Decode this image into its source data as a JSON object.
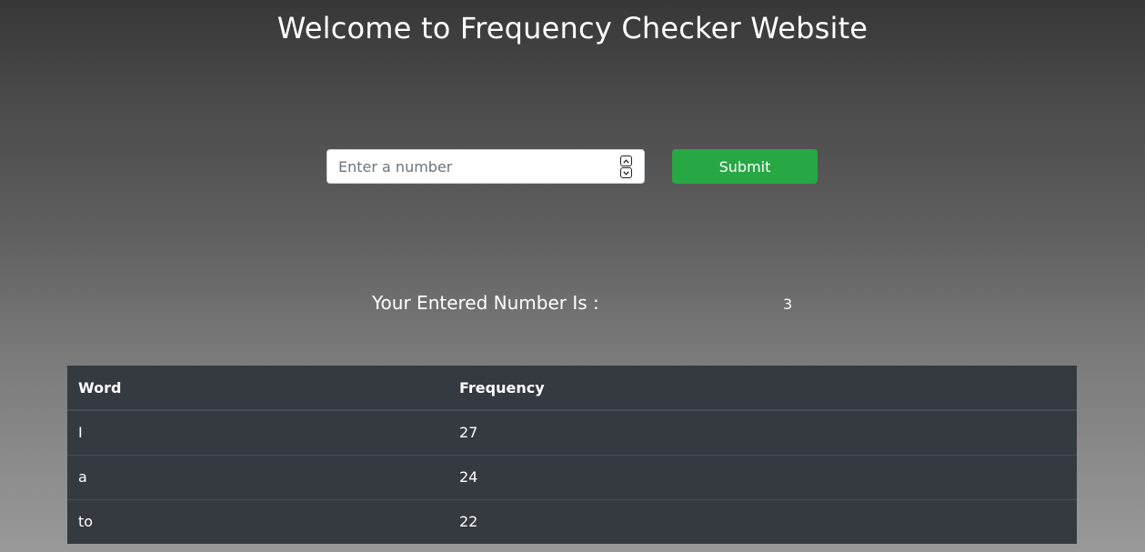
{
  "header": {
    "title": "Welcome to Frequency Checker Website"
  },
  "form": {
    "input_placeholder": "Enter a number",
    "input_value": "",
    "submit_label": "Submit"
  },
  "result": {
    "label": "Your Entered Number Is :",
    "value": "3"
  },
  "table": {
    "columns": [
      "Word",
      "Frequency"
    ],
    "rows": [
      {
        "word": "I",
        "frequency": "27"
      },
      {
        "word": "a",
        "frequency": "24"
      },
      {
        "word": "to",
        "frequency": "22"
      }
    ]
  },
  "colors": {
    "submit_button": "#28a745",
    "table_background": "#343a40"
  },
  "icons": {
    "spinner_up": "chevron-up-icon",
    "spinner_down": "chevron-down-icon"
  }
}
